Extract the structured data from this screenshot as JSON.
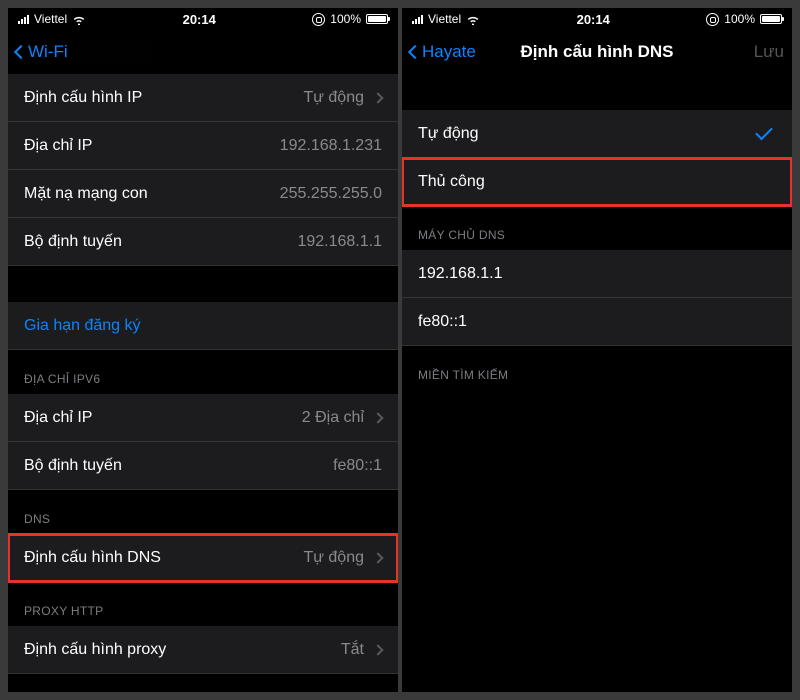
{
  "status": {
    "carrier": "Viettel",
    "time": "20:14",
    "battery_pct": "100%"
  },
  "left": {
    "nav_back": "Wi-Fi",
    "rows": {
      "ip_config": {
        "label": "Định cấu hình IP",
        "value": "Tự động"
      },
      "ip_addr": {
        "label": "Địa chỉ IP",
        "value": "192.168.1.231"
      },
      "subnet": {
        "label": "Mặt nạ mạng con",
        "value": "255.255.255.0"
      },
      "router": {
        "label": "Bộ định tuyến",
        "value": "192.168.1.1"
      },
      "renew": {
        "label": "Gia hạn đăng ký"
      }
    },
    "ipv6_header": "ĐỊA CHỈ IPV6",
    "ipv6": {
      "addr": {
        "label": "Địa chỉ IP",
        "value": "2 Địa chỉ"
      },
      "router": {
        "label": "Bộ định tuyến",
        "value": "fe80::1"
      }
    },
    "dns_header": "DNS",
    "dns": {
      "label": "Định cấu hình DNS",
      "value": "Tự động"
    },
    "proxy_header": "PROXY HTTP",
    "proxy": {
      "label": "Định cấu hình proxy",
      "value": "Tắt"
    }
  },
  "right": {
    "nav_back": "Hayate",
    "nav_title": "Định cấu hình DNS",
    "nav_save": "Lưu",
    "opt_auto": "Tự động",
    "opt_manual": "Thủ công",
    "dns_header": "MÁY CHỦ DNS",
    "servers": {
      "a": "192.168.1.1",
      "b": "fe80::1"
    },
    "search_header": "MIỀN TÌM KIẾM"
  }
}
